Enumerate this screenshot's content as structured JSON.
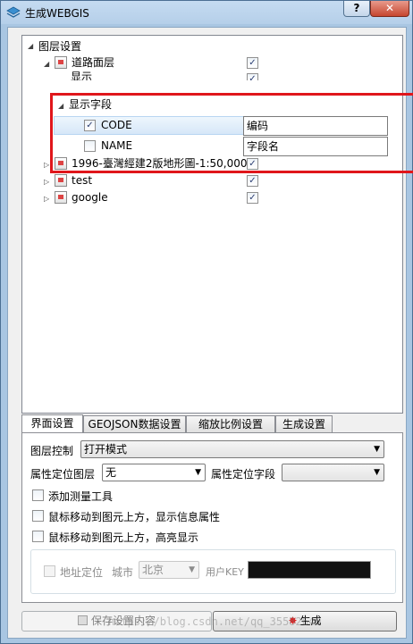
{
  "window": {
    "title": "生成WEBGIS",
    "help_label": "?",
    "close_label": "✕"
  },
  "tree": {
    "root": {
      "label": "图层设置",
      "expander": "◢"
    },
    "items": [
      {
        "label": "道路面层",
        "checked": true,
        "expander": "◢"
      },
      {
        "label": "显示",
        "checked": true
      },
      {
        "label": "显示字段",
        "expander": "◢"
      },
      {
        "label": "CODE",
        "checked": true,
        "value": "编码"
      },
      {
        "label": "NAME",
        "checked": false,
        "value": "字段名"
      },
      {
        "label": "1996-臺灣經建2版地形圖-1:50,000",
        "checked": true,
        "expander": "▷"
      },
      {
        "label": "test",
        "checked": true,
        "expander": "▷"
      },
      {
        "label": "google",
        "checked": true,
        "expander": "▷"
      }
    ]
  },
  "tabs": [
    {
      "label": "界面设置",
      "active": true
    },
    {
      "label": "GEOJSON数据设置",
      "active": false
    },
    {
      "label": "缩放比例设置",
      "active": false
    },
    {
      "label": "生成设置",
      "active": false
    }
  ],
  "panel": {
    "layer_control_label": "图层控制",
    "layer_control_value": "打开模式",
    "attr_layer_label": "属性定位图层",
    "attr_layer_value": "无",
    "attr_field_label": "属性定位字段",
    "attr_field_value": "",
    "opt_measure": "添加测量工具",
    "opt_hover_info": "鼠标移动到图元上方，显示信息属性",
    "opt_hover_highlight": "鼠标移动到图元上方，高亮显示",
    "addr_label": "地址定位",
    "city_label": "城市",
    "city_value": "北京",
    "userkey_label": "用户KEY"
  },
  "buttons": {
    "save": "保存设置内容",
    "generate": "生成"
  },
  "watermark": "https://blog.csdn.net/qq_35582640",
  "colors": {
    "highlight_box": "#e0161b"
  }
}
